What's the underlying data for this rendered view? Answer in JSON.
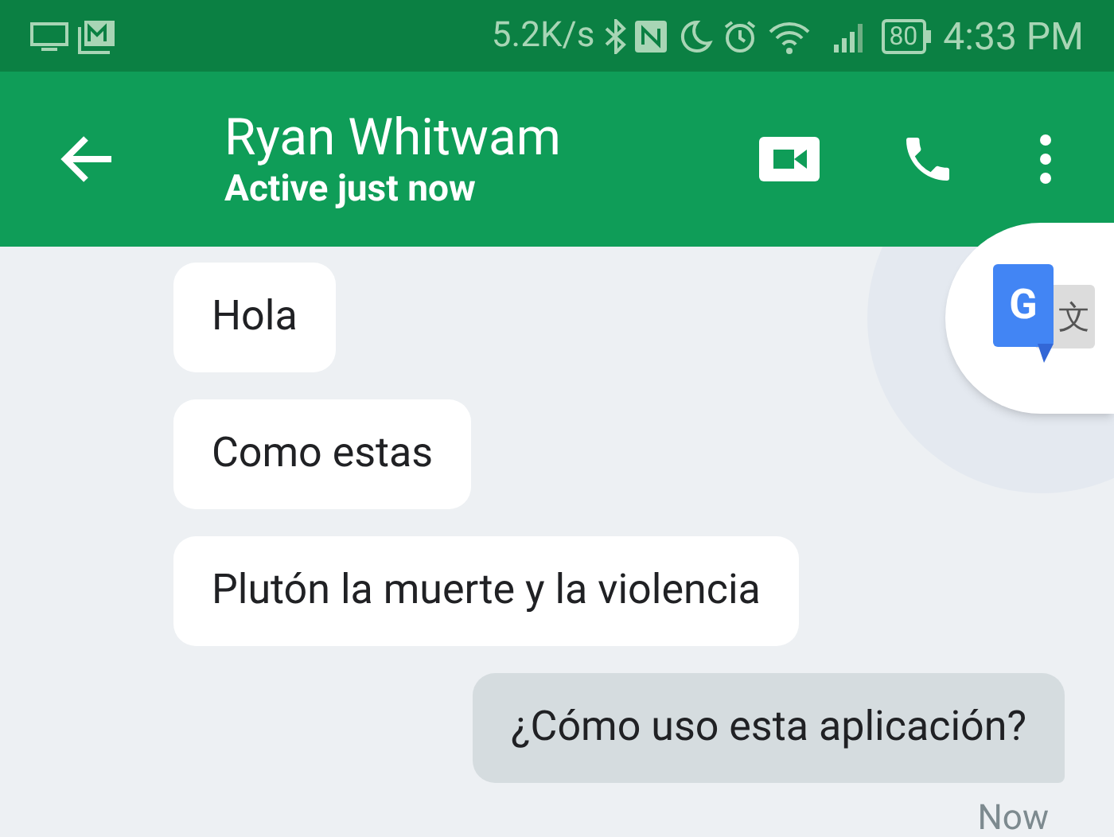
{
  "status_bar": {
    "speed": "5.2K/s",
    "battery": "80",
    "time": "4:33 PM"
  },
  "header": {
    "name": "Ryan Whitwam",
    "presence": "Active just now"
  },
  "messages": [
    {
      "text": "Hola",
      "sent": false
    },
    {
      "text": "Como estas",
      "sent": false
    },
    {
      "text": "Plutón la muerte y la violencia",
      "sent": false
    },
    {
      "text": "¿Cómo uso esta aplicación?",
      "sent": true
    }
  ],
  "timestamp": "Now",
  "translate_bubble": {
    "letter": "G",
    "glyph": "文"
  }
}
